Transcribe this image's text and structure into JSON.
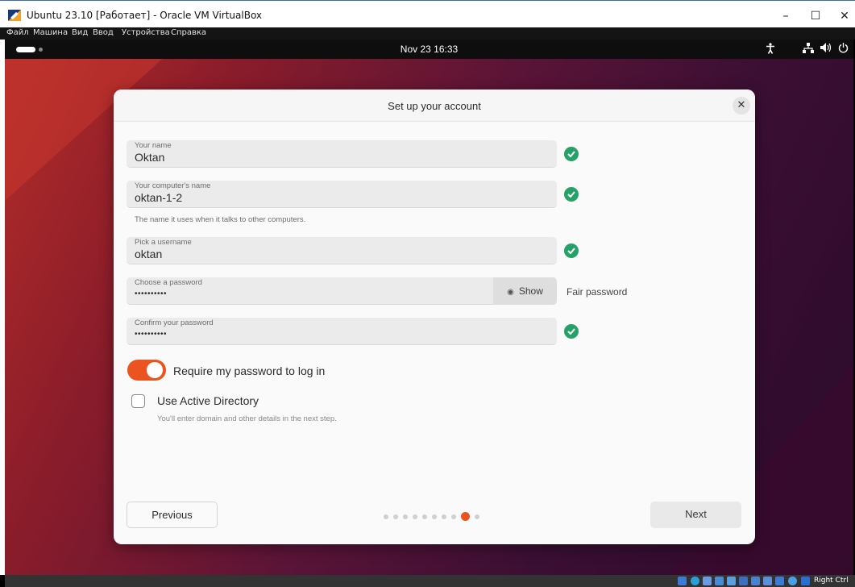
{
  "window": {
    "title": "Ubuntu 23.10 [Работает] - Oracle VM VirtualBox",
    "controls": {
      "minimize": "–",
      "maximize": "☐",
      "close": "✕"
    }
  },
  "menubar": {
    "items": [
      "Файл",
      "Машина",
      "Вид",
      "Ввод",
      "Устройства",
      "Справка"
    ]
  },
  "gnome": {
    "clock": "Nov 23  16:33",
    "tray_icons": [
      "accessibility-icon",
      "network-icon",
      "volume-icon",
      "power-icon"
    ]
  },
  "dialog": {
    "title": "Set up your account",
    "close_label": "✕",
    "fields": [
      {
        "label": "Your name",
        "value": "Oktan",
        "valid": true
      },
      {
        "label": "Your computer's name",
        "value": "oktan-1-2",
        "valid": true,
        "hint": "The name it uses when it talks to other computers."
      },
      {
        "label": "Pick a username",
        "value": "oktan",
        "valid": true
      },
      {
        "label": "Choose a password",
        "value": "••••••••••",
        "show_label": "Show",
        "strength": "Fair password"
      },
      {
        "label": "Confirm your password",
        "value": "••••••••••",
        "valid": true
      }
    ],
    "require_password": {
      "label": "Require my password to log in",
      "checked": true
    },
    "active_directory": {
      "label": "Use Active Directory",
      "checked": false,
      "hint": "You'll enter domain and other details in the next step."
    },
    "previous_label": "Previous",
    "next_label": "Next",
    "progress": {
      "total_steps": 10,
      "current_step": 9
    }
  },
  "statusbar": {
    "host_key": "Right Ctrl"
  },
  "colors": {
    "accent": "#e95420",
    "valid": "#26a269"
  }
}
